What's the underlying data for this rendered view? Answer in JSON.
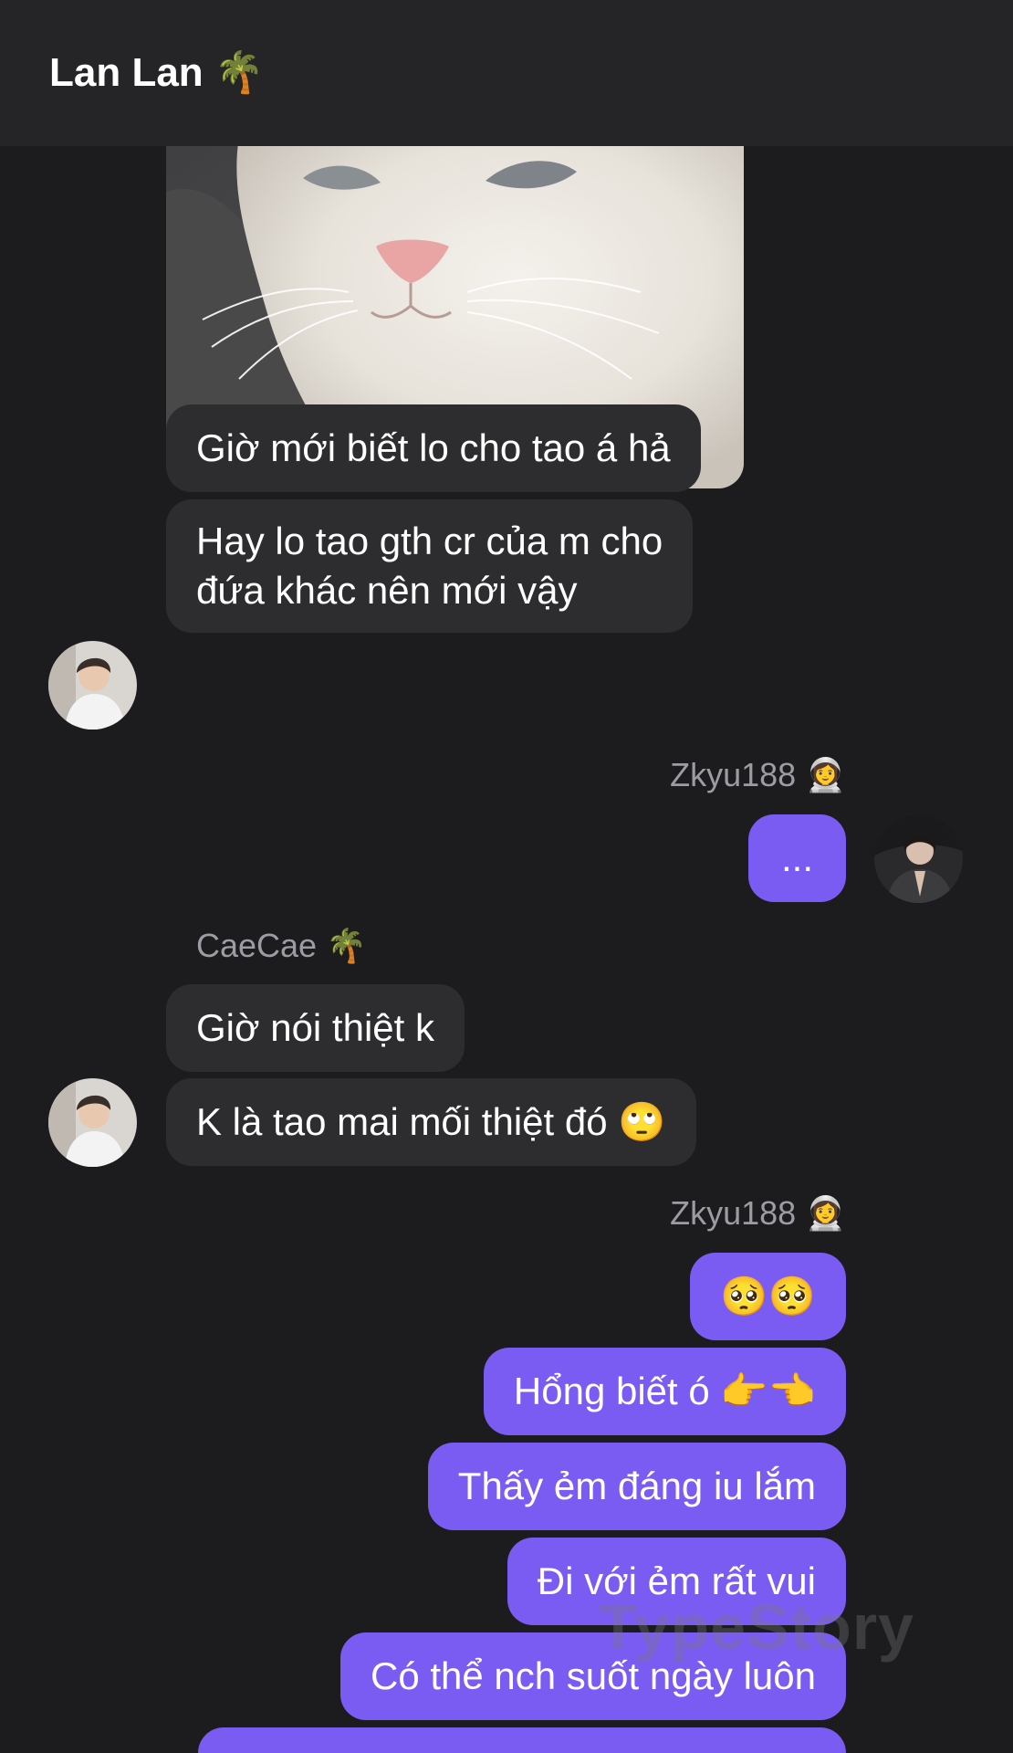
{
  "header": {
    "title": "Lan Lan 🌴"
  },
  "messages": {
    "m1": "Giờ mới biết lo cho tao á hả",
    "m2_line1": "Hay lo tao gth cr của m cho",
    "m2_line2": "đứa khác nên mới vậy",
    "sender_zkyu_1": "Zkyu188 👩‍🚀",
    "m3": "...",
    "sender_caecae": "CaeCae 🌴",
    "m4": "Giờ nói thiệt k",
    "m5": "K là tao mai mối thiệt đó 🙄",
    "sender_zkyu_2": "Zkyu188 👩‍🚀",
    "m6": "🥺🥺",
    "m7": "Hổng biết ó 👉👈",
    "m8": "Thấy ẻm đáng iu lắm",
    "m9": "Đi với ẻm rất vui",
    "m10": "Có thể nch suốt ngày luôn"
  },
  "watermark": "TypeStory",
  "colors": {
    "background": "#1c1c1e",
    "header": "#252527",
    "incoming_bubble": "#2d2d30",
    "outgoing_bubble": "#7b5cf2",
    "sender_name": "#9c9ca3"
  }
}
